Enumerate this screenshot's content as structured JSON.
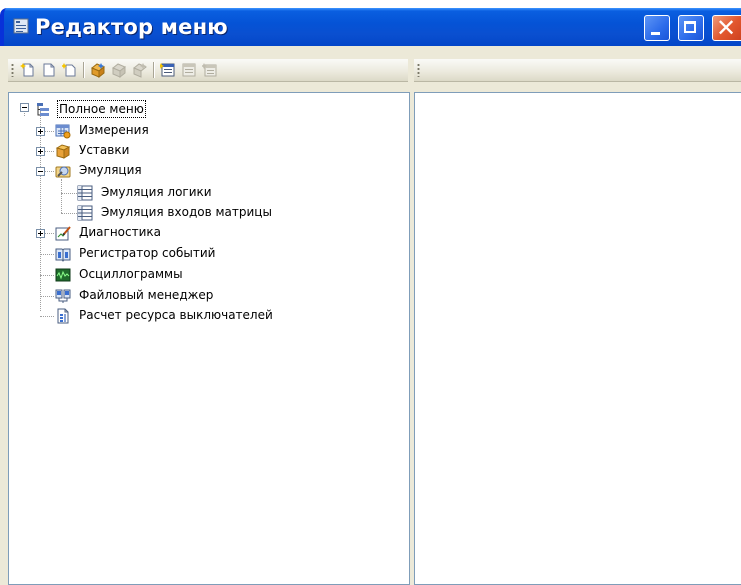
{
  "window": {
    "title": "Редактор меню",
    "title_icon": "menu-editor-icon",
    "controls": [
      "minimize",
      "maximize",
      "close"
    ]
  },
  "toolbar": {
    "buttons": [
      {
        "name": "new-item-icon"
      },
      {
        "name": "new-document-icon"
      },
      {
        "name": "new-sibling-icon"
      },
      {
        "name": "add-group-icon"
      },
      {
        "name": "add-group-disabled-icon"
      },
      {
        "name": "remove-group-disabled-icon"
      },
      {
        "name": "properties-icon"
      },
      {
        "name": "edit-disabled-icon"
      },
      {
        "name": "delete-disabled-icon"
      }
    ]
  },
  "tree": {
    "root": {
      "label": "Полное меню",
      "icon": "menu-tree-icon",
      "expanded": true,
      "selected": true
    },
    "items": [
      {
        "label": "Измерения",
        "icon": "measurements-icon",
        "expandable": true,
        "expanded": false
      },
      {
        "label": "Уставки",
        "icon": "settings-box-icon",
        "expandable": true,
        "expanded": false
      },
      {
        "label": "Эмуляция",
        "icon": "emulation-icon",
        "expandable": true,
        "expanded": true,
        "children": [
          {
            "label": "Эмуляция логики",
            "icon": "table-icon"
          },
          {
            "label": "Эмуляция входов матрицы",
            "icon": "table-icon"
          }
        ]
      },
      {
        "label": "Диагностика",
        "icon": "diagnostics-icon",
        "expandable": true,
        "expanded": false
      },
      {
        "label": "Регистратор событий",
        "icon": "event-log-icon",
        "expandable": false
      },
      {
        "label": "Осциллограммы",
        "icon": "oscillogram-icon",
        "expandable": false
      },
      {
        "label": "Файловый менеджер",
        "icon": "file-manager-icon",
        "expandable": false
      },
      {
        "label": "Расчет ресурса выключателей",
        "icon": "breaker-calc-icon",
        "expandable": false
      }
    ]
  }
}
